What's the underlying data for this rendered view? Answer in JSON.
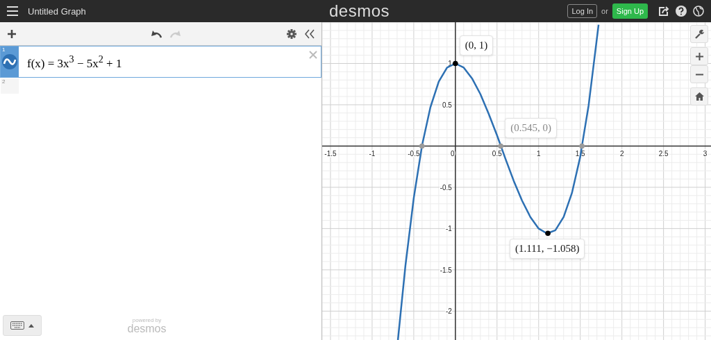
{
  "header": {
    "title": "Untitled Graph",
    "logo": "desmos",
    "login": "Log In",
    "or": "or",
    "signup": "Sign Up"
  },
  "expressions": [
    {
      "number": "1",
      "latex": "f(x) = 3x$^{3}$ − 5x$^{2}$ + 1",
      "selected": true
    },
    {
      "number": "2",
      "selected": false
    }
  ],
  "footer": {
    "powered": "powered by",
    "logo": "desmos"
  },
  "graph": {
    "chart_data": {
      "type": "line",
      "grid": true,
      "xlim": [
        -1.6,
        3.07
      ],
      "ylim": [
        -2.35,
        1.5
      ],
      "xticks": [
        -1.5,
        -1,
        -0.5,
        0,
        0.5,
        1,
        1.5,
        2,
        2.5,
        3
      ],
      "yticks": [
        -2,
        -1.5,
        -1,
        -0.5,
        0.5,
        1
      ],
      "x": [
        -0.69,
        -0.6,
        -0.5,
        -0.4,
        -0.3,
        -0.2,
        -0.1,
        0,
        0.1,
        0.2,
        0.3,
        0.4,
        0.5,
        0.6,
        0.7,
        0.8,
        0.9,
        1,
        1.1,
        1.2,
        1.3,
        1.4,
        1.5,
        1.52,
        1.6,
        1.72
      ],
      "series": [
        {
          "color": "#2d70b3",
          "values": [
            -2.35,
            -1.45,
            -0.63,
            0.01,
            0.47,
            0.78,
            0.95,
            1,
            0.95,
            0.82,
            0.63,
            0.39,
            0.13,
            -0.15,
            -0.42,
            -0.66,
            -0.86,
            -1,
            -1.06,
            -1.02,
            -0.86,
            -0.57,
            -0.13,
            0,
            0.49,
            1.47
          ]
        }
      ],
      "annotations": [
        {
          "x": 0,
          "y": 1,
          "text": "(0, 1)"
        },
        {
          "x": 0.545,
          "y": 0,
          "text": "(0.545, 0)"
        },
        {
          "x": 1.111,
          "y": -1.058,
          "text": "(1.111, −1.058)"
        }
      ]
    }
  }
}
